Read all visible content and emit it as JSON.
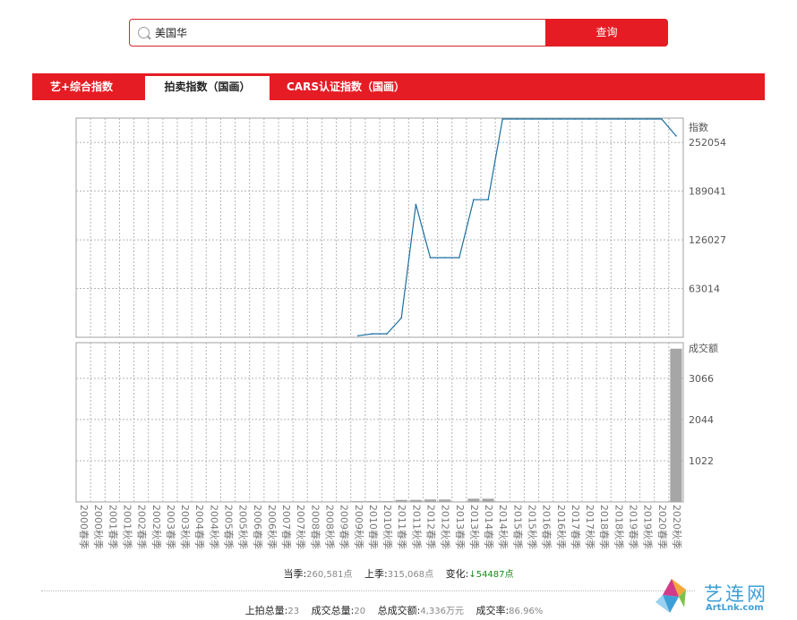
{
  "search": {
    "value": "美国华",
    "button_label": "查询"
  },
  "tabs": [
    {
      "label": "艺+综合指数"
    },
    {
      "label": "拍卖指数（国画）"
    },
    {
      "label": "CARS认证指数（国画）"
    }
  ],
  "colors": {
    "accent": "#e51c23",
    "line": "#1a6fa0",
    "bar": "#a6a6a6",
    "change_down": "#1a8a1a",
    "watermark": "#3d9fd8"
  },
  "chart_data": [
    {
      "type": "line",
      "title": "",
      "ylabel": "指数",
      "ylim": [
        0,
        283560
      ],
      "yticks": [
        63014,
        126027,
        189041,
        252054
      ],
      "x": [
        "2009秋季",
        "2010春季",
        "2010秋季",
        "2011春季",
        "2011秋季",
        "2012春季",
        "2012秋季",
        "2013春季",
        "2013秋季",
        "2014春季",
        "2014秋季",
        "2015春季",
        "2015秋季",
        "2016春季",
        "2016秋季",
        "2017春季",
        "2017秋季",
        "2018春季",
        "2018秋季",
        "2019春季",
        "2019秋季",
        "2020春季",
        "2020秋季"
      ],
      "series": [
        {
          "values": [
            2000,
            4500,
            4500,
            25000,
            172000,
            103000,
            103000,
            103000,
            178000,
            178000,
            315068,
            315068,
            315068,
            315068,
            315068,
            315068,
            315068,
            315068,
            315068,
            315068,
            315068,
            315068,
            260581
          ]
        }
      ]
    },
    {
      "type": "bar",
      "title": "",
      "ylabel": "成交额",
      "ylim": [
        0,
        3950
      ],
      "yticks": [
        1022,
        2044,
        3066
      ],
      "categories": [
        "2000春季",
        "2000秋季",
        "2001春季",
        "2001秋季",
        "2002春季",
        "2002秋季",
        "2003春季",
        "2003秋季",
        "2004春季",
        "2004秋季",
        "2005春季",
        "2005秋季",
        "2006春季",
        "2006秋季",
        "2007春季",
        "2007秋季",
        "2008春季",
        "2008秋季",
        "2009春季",
        "2009秋季",
        "2010春季",
        "2010秋季",
        "2011春季",
        "2011秋季",
        "2012春季",
        "2012秋季",
        "2013春季",
        "2013秋季",
        "2014春季",
        "2014秋季",
        "2015春季",
        "2015秋季",
        "2016春季",
        "2016秋季",
        "2017春季",
        "2017秋季",
        "2018春季",
        "2018秋季",
        "2019春季",
        "2019秋季",
        "2020春季",
        "2020秋季"
      ],
      "values": [
        0,
        0,
        0,
        0,
        0,
        0,
        0,
        0,
        0,
        0,
        0,
        0,
        0,
        0,
        0,
        0,
        0,
        0,
        0,
        20,
        20,
        20,
        50,
        50,
        60,
        60,
        0,
        80,
        80,
        15,
        15,
        0,
        0,
        0,
        0,
        0,
        0,
        0,
        0,
        0,
        0,
        3800
      ]
    }
  ],
  "stats": {
    "current_label": "当季:",
    "current_value": "260,581点",
    "prev_label": "上季:",
    "prev_value": "315,068点",
    "change_label": "变化:",
    "change_value": "↓54487点",
    "total_label": "上拍总量:",
    "total_value": "23",
    "sold_label": "成交总量:",
    "sold_value": "20",
    "amount_label": "总成交额:",
    "amount_value": "4,336万元",
    "rate_label": "成交率:",
    "rate_value": "86.96%"
  },
  "watermark": {
    "title": "艺连网",
    "url": "ArtLnk.com"
  }
}
